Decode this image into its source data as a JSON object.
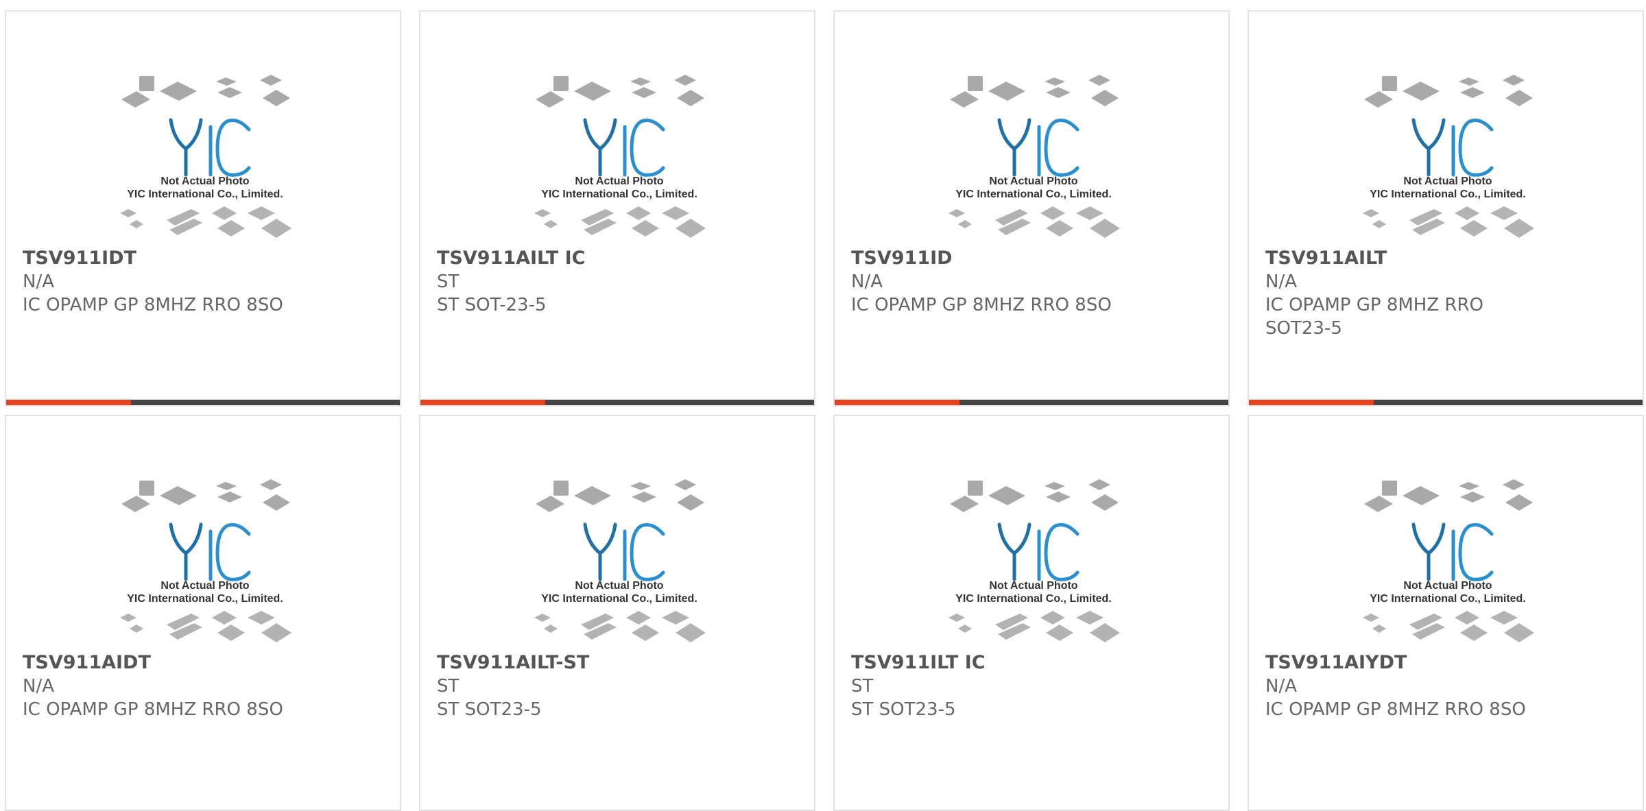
{
  "accent_color": "#e8401c",
  "bar_color": "#444444",
  "products": [
    {
      "part_number": "TSV911IDT",
      "manufacturer": "N/A",
      "description": "IC OPAMP GP 8MHZ RRO 8SO",
      "image_caption_1": "Not Actual Photo",
      "image_caption_2": "YIC International Co., Limited."
    },
    {
      "part_number": "TSV911AILT IC",
      "manufacturer": "ST",
      "description": "ST SOT-23-5",
      "image_caption_1": "Not Actual Photo",
      "image_caption_2": "YIC International Co., Limited."
    },
    {
      "part_number": "TSV911ID",
      "manufacturer": "N/A",
      "description": "IC OPAMP GP 8MHZ RRO 8SO",
      "image_caption_1": "Not Actual Photo",
      "image_caption_2": "YIC International Co., Limited."
    },
    {
      "part_number": "TSV911AILT",
      "manufacturer": "N/A",
      "description": "IC OPAMP GP 8MHZ RRO SOT23-5",
      "image_caption_1": "Not Actual Photo",
      "image_caption_2": "YIC International Co., Limited."
    },
    {
      "part_number": "TSV911AIDT",
      "manufacturer": "N/A",
      "description": "IC OPAMP GP 8MHZ RRO 8SO",
      "image_caption_1": "Not Actual Photo",
      "image_caption_2": "YIC International Co., Limited."
    },
    {
      "part_number": "TSV911AILT-ST",
      "manufacturer": "ST",
      "description": "ST SOT23-5",
      "image_caption_1": "Not Actual Photo",
      "image_caption_2": "YIC International Co., Limited."
    },
    {
      "part_number": "TSV911ILT IC",
      "manufacturer": "ST",
      "description": "ST SOT23-5",
      "image_caption_1": "Not Actual Photo",
      "image_caption_2": "YIC International Co., Limited."
    },
    {
      "part_number": "TSV911AIYDT",
      "manufacturer": "N/A",
      "description": "IC OPAMP GP 8MHZ RRO 8SO",
      "image_caption_1": "Not Actual Photo",
      "image_caption_2": "YIC International Co., Limited."
    }
  ]
}
